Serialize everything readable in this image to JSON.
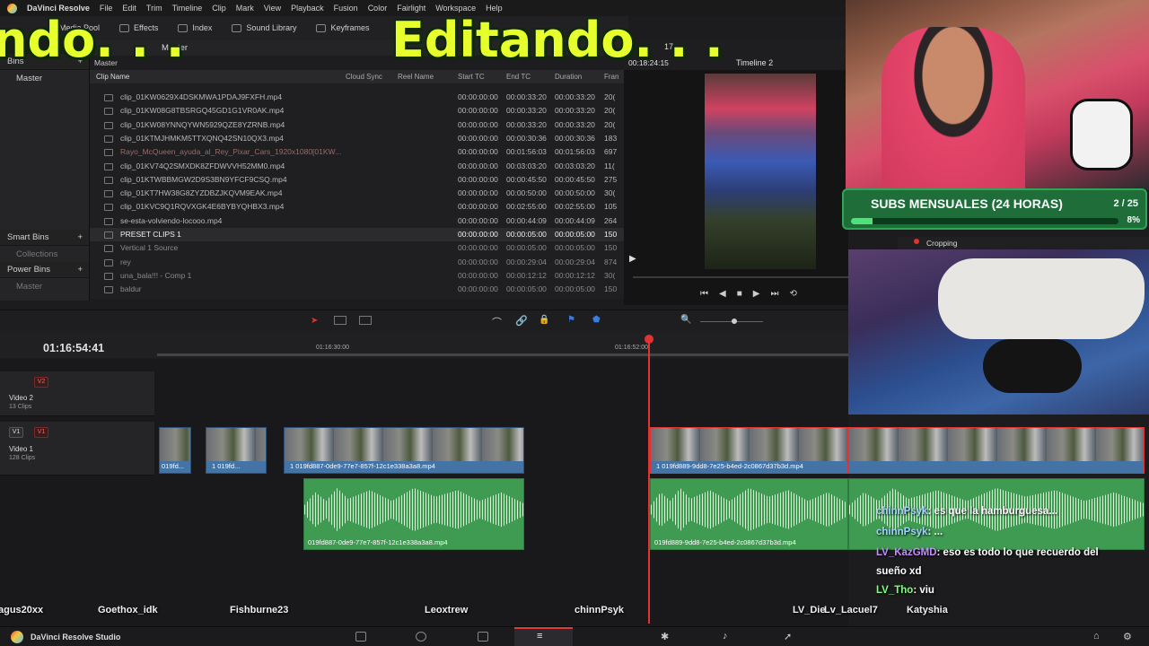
{
  "menu": {
    "app": "DaVinci Resolve",
    "items": [
      "File",
      "Edit",
      "Trim",
      "Timeline",
      "Clip",
      "Mark",
      "View",
      "Playback",
      "Fusion",
      "Color",
      "Fairlight",
      "Workspace",
      "Help"
    ]
  },
  "toolbar": {
    "media_pool": "Media Pool",
    "effects": "Effects",
    "index": "Index",
    "sound_library": "Sound Library",
    "keyframes": "Keyframes"
  },
  "overlay": {
    "text_left": "ndo. . .",
    "text_main": "Editando. . .",
    "text_right": "E"
  },
  "bins": {
    "header": "Bins",
    "master": "Master",
    "smart_bins": "Smart Bins",
    "collections": "Collections",
    "power_bins": "Power Bins",
    "power_master": "Master"
  },
  "media_pool": {
    "folder": "Master",
    "path": "Master",
    "columns": [
      "Clip Name",
      "Cloud Sync",
      "Reel Name",
      "Start TC",
      "End TC",
      "Duration",
      "Fran"
    ],
    "clips": [
      {
        "name": "clip_01KW0629X4DSKMWA1PDAJ9FXFH.mp4",
        "start": "00:00:00:00",
        "end": "00:00:33:20",
        "dur": "00:00:33:20",
        "fr": "20("
      },
      {
        "name": "clip_01KW08G8TBSRGQ45GD1G1VR0AK.mp4",
        "start": "00:00:00:00",
        "end": "00:00:33:20",
        "dur": "00:00:33:20",
        "fr": "20("
      },
      {
        "name": "clip_01KW08YNNQYWN5929QZE8YZRNB.mp4",
        "start": "00:00:00:00",
        "end": "00:00:33:20",
        "dur": "00:00:33:20",
        "fr": "20("
      },
      {
        "name": "clip_01KTMJHMKM5TTXQNQ42SN10QX3.mp4",
        "start": "00:00:00:00",
        "end": "00:00:30:36",
        "dur": "00:00:30:36",
        "fr": "183"
      },
      {
        "name": "Rayo_McQueen_ayuda_al_Rey_Pixar_Cars_1920x1080[01KW...",
        "start": "00:00:00:00",
        "end": "00:01:56:03",
        "dur": "00:01:56:03",
        "fr": "697"
      },
      {
        "name": "clip_01KV74Q2SMXDK8ZFDWVVH52MM0.mp4",
        "start": "00:00:00:00",
        "end": "00:03:03:20",
        "dur": "00:03:03:20",
        "fr": "11("
      },
      {
        "name": "clip_01KTWBBMGW2D9S3BN9YFCF9CSQ.mp4",
        "start": "00:00:00:00",
        "end": "00:00:45:50",
        "dur": "00:00:45:50",
        "fr": "275"
      },
      {
        "name": "clip_01KT7HW38G8ZYZDBZJKQVM9EAK.mp4",
        "start": "00:00:00:00",
        "end": "00:00:50:00",
        "dur": "00:00:50:00",
        "fr": "30("
      },
      {
        "name": "clip_01KVC9Q1RQVXGK4E6BYBYQHBX3.mp4",
        "start": "00:00:00:00",
        "end": "00:02:55:00",
        "dur": "00:02:55:00",
        "fr": "105"
      },
      {
        "name": "se-esta-volviendo-locooo.mp4",
        "start": "00:00:00:00",
        "end": "00:00:44:09",
        "dur": "00:00:44:09",
        "fr": "264"
      },
      {
        "name": "PRESET CLIPS 1",
        "start": "00:00:00:00",
        "end": "00:00:05:00",
        "dur": "00:00:05:00",
        "fr": "150"
      },
      {
        "name": "Vertical 1 Source",
        "start": "00:00:00:00",
        "end": "00:00:05:00",
        "dur": "00:00:05:00",
        "fr": "150"
      },
      {
        "name": "rey",
        "start": "00:00:00:00",
        "end": "00:00:29:04",
        "dur": "00:00:29:04",
        "fr": "874"
      },
      {
        "name": "una_bala!!! - Comp 1",
        "start": "00:00:00:00",
        "end": "00:00:12:12",
        "dur": "00:00:12:12",
        "fr": "30("
      },
      {
        "name": "baldur",
        "start": "00:00:00:00",
        "end": "00:00:05:00",
        "dur": "00:00:05:00",
        "fr": "150"
      }
    ]
  },
  "viewer": {
    "timecode": "00:18:24:15",
    "timeline_name": "Timeline 2",
    "zoom": "17"
  },
  "timeline": {
    "timecode": "01:16:54:41",
    "ruler_marks": [
      "01:16:30:00",
      "01:16:52:00"
    ],
    "tracks": [
      {
        "id": "V2",
        "name": "Video 2",
        "clips": "13 Clips"
      },
      {
        "id": "V1",
        "name": "Video 1",
        "clips": "128 Clips"
      }
    ],
    "video_clips": [
      {
        "label": "019fd..."
      },
      {
        "label": "1 019fd..."
      },
      {
        "label": "1 019fd887-0de9-77e7-857f-12c1e338a3a8.mp4"
      },
      {
        "label": "1 019fd889-9dd8-7e25-b4ed-2c0867d37b3d.mp4"
      }
    ],
    "audio_clips": [
      {
        "label": "019fd887-0de9-77e7-857f-12c1e338a3a8.mp4"
      },
      {
        "label": "019fd889-9dd8-7e25-b4ed-2c0867d37b3d.mp4"
      }
    ]
  },
  "stream": {
    "subs_title": "SUBS MENSUALES (24 HORAS)",
    "subs_count": "2 / 25",
    "subs_pct": "8%",
    "subs_progress": 0.08,
    "cam2_label": "Cropping",
    "chat": [
      {
        "user": "chinnPsyk",
        "msg": ": es que la hamburguesa...",
        "color": "#9fd4ff"
      },
      {
        "user": "chinnPsyk",
        "msg": ": ...",
        "color": "#9fd4ff"
      },
      {
        "user": "LV_KazGMD",
        "msg": ": eso es todo lo que recuerdo del",
        "color": "#c48bff"
      },
      {
        "user": "",
        "msg": "sueño xd",
        "color": "#ffffff"
      },
      {
        "user": "LV_Tho",
        "msg": ": viu",
        "color": "#7dff7d"
      }
    ],
    "viewers": [
      "agus20xx",
      "Goethox_idk",
      "Fishburne23",
      "Leoxtrew",
      "chinnPsyk",
      "LV_Die",
      "Lv_Lacuel7",
      "Katyshia"
    ]
  },
  "bottom": {
    "brand": "DaVinci Resolve Studio"
  }
}
